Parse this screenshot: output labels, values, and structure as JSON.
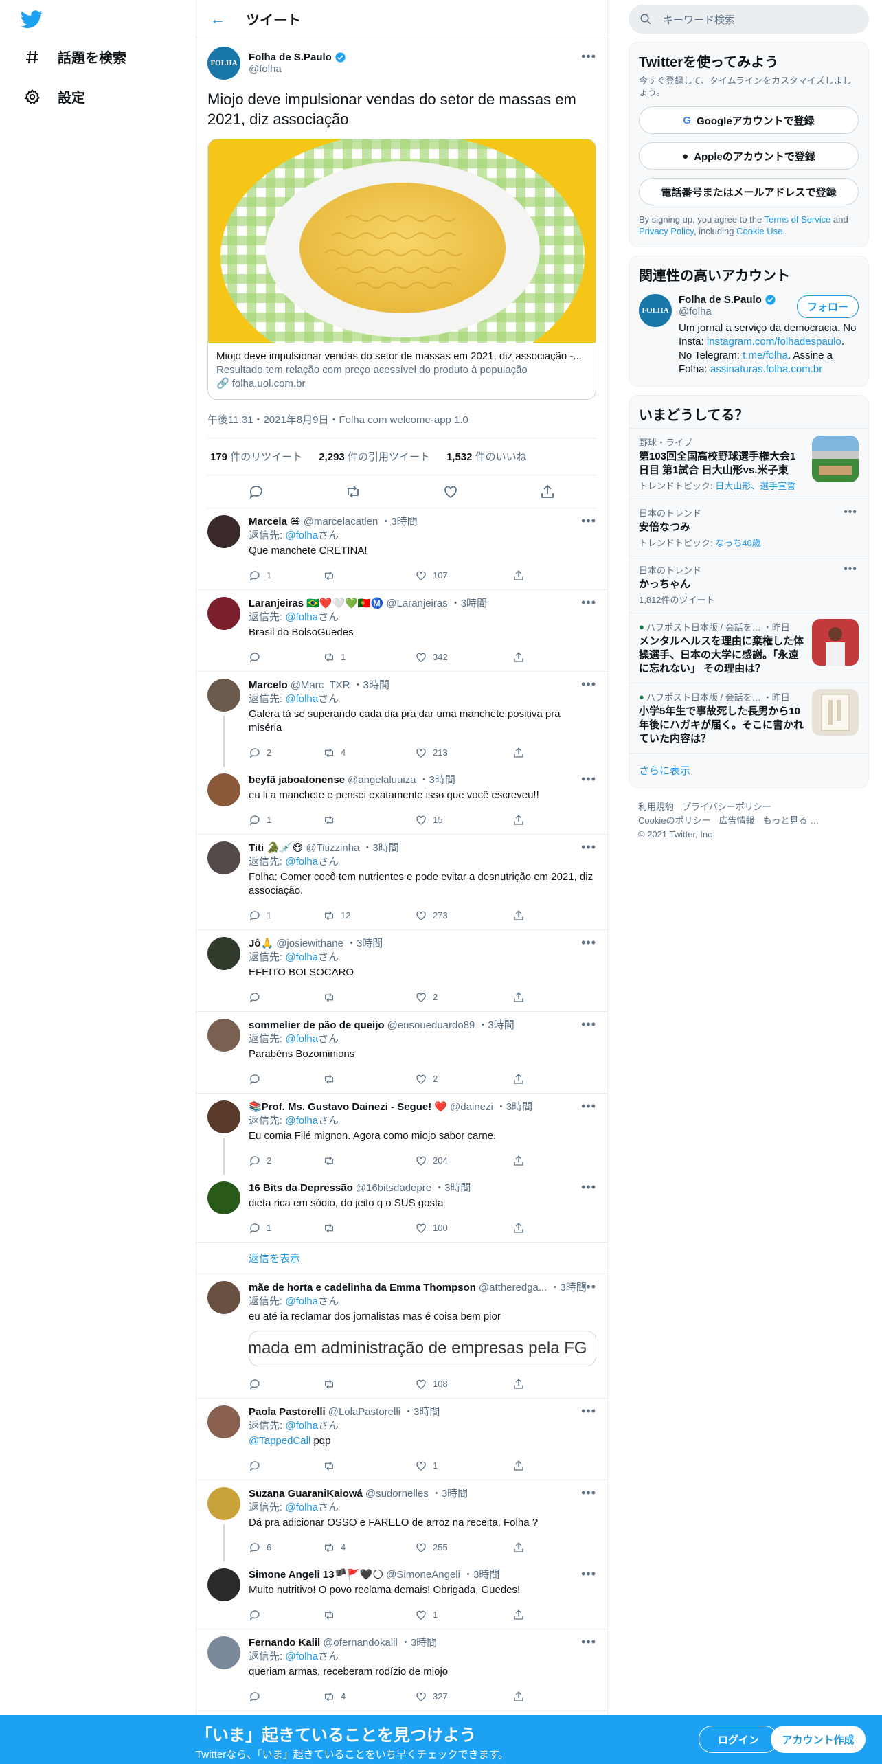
{
  "nav": {
    "explore": "話題を検索",
    "settings": "設定"
  },
  "main": {
    "title": "ツイート",
    "tweet": {
      "name": "Folha de S.Paulo",
      "handle": "@folha",
      "text": "Miojo deve impulsionar vendas do setor de massas em 2021, diz associação",
      "card_title": "Miojo deve impulsionar vendas do setor de massas em 2021, diz associação -...",
      "card_desc": "Resultado tem relação com preço acessível do produto à população",
      "card_domain": "folha.uol.com.br",
      "meta": "午後11:31・2021年8月9日・Folha com welcome-app 1.0",
      "retweets": "179",
      "retweets_label": "件のリツイート",
      "quotes": "2,293",
      "quotes_label": "件の引用ツイート",
      "likes": "1,532",
      "likes_label": "件のいいね"
    },
    "replying_label": "返信先:",
    "san": "さん",
    "show_replies": "返信を表示",
    "replies": [
      {
        "name": "Marcela 😷",
        "handle": "@marcelacatlen",
        "time": "・3時間",
        "to": "@folha",
        "text": "Que manchete CRETINA!",
        "reply": "1",
        "rt": "",
        "like": "107",
        "color": "#3a2a2a"
      },
      {
        "name": "Laranjeiras 🇧🇷❤️🤍💚🇵🇹Ⓜ️",
        "handle": "@Laranjeiras",
        "time": "・3時間",
        "to": "@folha",
        "text": "Brasil do BolsoGuedes",
        "reply": "",
        "rt": "1",
        "like": "342",
        "color": "#7a1f2b"
      },
      {
        "name": "Marcelo",
        "handle": "@Marc_TXR",
        "time": "・3時間",
        "to": "@folha",
        "text": "Galera tá se superando cada dia pra dar uma manchete positiva pra miséria",
        "reply": "2",
        "rt": "4",
        "like": "213",
        "color": "#6b5a4b"
      },
      {
        "name": "beyfã jaboatonense",
        "handle": "@angelaluuiza",
        "time": "・3時間",
        "to": "",
        "text": "eu li a manchete e pensei exatamente isso que você escreveu!!",
        "reply": "1",
        "rt": "",
        "like": "15",
        "color": "#8a5a3a"
      },
      {
        "name": "Titi 🐊💉😷",
        "handle": "@Titizzinha",
        "time": "・3時間",
        "to": "@folha",
        "text": "Folha: Comer cocô tem nutrientes e pode evitar a desnutrição em 2021, diz associação.",
        "reply": "1",
        "rt": "12",
        "like": "273",
        "color": "#554a4a"
      },
      {
        "name": "Jô🙏",
        "handle": "@josiewithane",
        "time": "・3時間",
        "to": "@folha",
        "text": "EFEITO BOLSOCARO",
        "reply": "",
        "rt": "",
        "like": "2",
        "color": "#2f3a2a"
      },
      {
        "name": "sommelier de pão de queijo",
        "handle": "@eusoueduardo89",
        "time": "・3時間",
        "to": "@folha",
        "text": "Parabéns Bozominions",
        "reply": "",
        "rt": "",
        "like": "2",
        "color": "#7a6050"
      },
      {
        "name": "📚Prof. Ms. Gustavo Dainezi - Segue! ❤️",
        "handle": "@dainezi",
        "time": "・3時間",
        "to": "@folha",
        "text": "Eu comia Filé mignon. Agora como miojo sabor carne.",
        "reply": "2",
        "rt": "",
        "like": "204",
        "color": "#5a3a2a"
      },
      {
        "name": "16 Bits da Depressão",
        "handle": "@16bitsdadepre",
        "time": "・3時間",
        "to": "",
        "text": "dieta rica em sódio, do jeito q o SUS gosta",
        "reply": "1",
        "rt": "",
        "like": "100",
        "color": "#2a5a1a"
      },
      {
        "name": "mãe de horta e cadelinha da Emma Thompson",
        "handle": "@attheredga...",
        "time": "・3時間",
        "to": "@folha",
        "text": "eu até ia reclamar dos jornalistas mas é coisa bem pior",
        "embed": "rmada em administração de empresas pela FG",
        "reply": "",
        "rt": "",
        "like": "108",
        "color": "#6a5040"
      },
      {
        "name": "Paola Pastorelli",
        "handle": "@LolaPastorelli",
        "time": "・3時間",
        "to": "@folha",
        "mention": "@TappedCall",
        "text": " pqp",
        "reply": "",
        "rt": "",
        "like": "1",
        "color": "#8a6050"
      },
      {
        "name": "Suzana GuaraniKaiowá",
        "handle": "@sudornelles",
        "time": "・3時間",
        "to": "@folha",
        "text": "Dá pra adicionar OSSO e FARELO de arroz na receita, Folha ?",
        "reply": "6",
        "rt": "4",
        "like": "255",
        "color": "#c9a23a"
      },
      {
        "name": "Simone Angeli 13🏴🚩🖤🌕",
        "handle": "@SimoneAngeli",
        "time": "・3時間",
        "to": "",
        "text": "Muito nutritivo! O povo reclama demais! Obrigada, Guedes!",
        "reply": "",
        "rt": "",
        "like": "1",
        "color": "#2a2a2a"
      },
      {
        "name": "Fernando Kalil",
        "handle": "@ofernandokalil",
        "time": "・3時間",
        "to": "@folha",
        "text": "queriam armas, receberam rodízio de miojo",
        "reply": "",
        "rt": "4",
        "like": "327",
        "color": "#7a8a9a"
      }
    ]
  },
  "right": {
    "search_placeholder": "キーワード検索",
    "signup": {
      "title": "Twitterを使ってみよう",
      "desc": "今すぐ登録して、タイムラインをカスタマイズしましょう。",
      "google": "Googleアカウントで登録",
      "apple": "Appleのアカウントで登録",
      "phone": "電話番号またはメールアドレスで登録",
      "terms_pre": "By signing up, you agree to the ",
      "terms_tos": "Terms of Service",
      "terms_and": " and ",
      "terms_privacy": "Privacy Policy",
      "terms_incl": ", including ",
      "terms_cookie": "Cookie Use",
      "terms_end": "."
    },
    "related": {
      "title": "関連性の高いアカウント",
      "name": "Folha de S.Paulo",
      "handle": "@folha",
      "follow": "フォロー",
      "bio1": "Um jornal a serviço da democracia. No Insta: ",
      "bio_link1": "instagram.com/folhadespaulo",
      "bio2": ". No Telegram: ",
      "bio_link2": "t.me/folha",
      "bio3": ". Assine a Folha: ",
      "bio_link3": "assinaturas.folha.com.br"
    },
    "trends": {
      "title": "いまどうしてる？",
      "items": [
        {
          "ctx": "野球・ライブ",
          "name": "第103回全国高校野球選手権大会1日目 第1試合 日大山形vs.米子東",
          "sub_label": "トレンドトピック: ",
          "sub": "日大山形、選手宣誓"
        },
        {
          "ctx": "日本のトレンド",
          "name": "安倍なつみ",
          "sub_label": "トレンドトピック: ",
          "sub": "なっち40歳"
        },
        {
          "ctx": "日本のトレンド",
          "name": "かっちゃん",
          "sub_label": "",
          "sub": "1,812件のツイート"
        },
        {
          "ctx": "ハフポスト日本版 / 会話を…",
          "ctx_time": "・昨日",
          "name": "メンタルヘルスを理由に棄権した体操選手、日本の大学に感謝。「永遠に忘れない」 その理由は？"
        },
        {
          "ctx": "ハフポスト日本版 / 会話を…",
          "ctx_time": "・昨日",
          "name": "小学5年生で事故死した長男から10年後にハガキが届く。そこに書かれていた内容は？"
        }
      ],
      "more": "さらに表示"
    },
    "footer": {
      "l1": "利用規約",
      "l2": "プライバシーポリシー",
      "l3": "Cookieのポリシー",
      "l4": "広告情報",
      "l5": "もっと見る …",
      "copy": "© 2021 Twitter, Inc."
    }
  },
  "bottom": {
    "title": "「いま」起きていることを見つけよう",
    "sub": "Twitterなら、「いま」起きていることをいち早くチェックできます。",
    "login": "ログイン",
    "signup": "アカウント作成"
  },
  "colors": {
    "accent": "#1da1f2",
    "link": "#1b95e0"
  }
}
